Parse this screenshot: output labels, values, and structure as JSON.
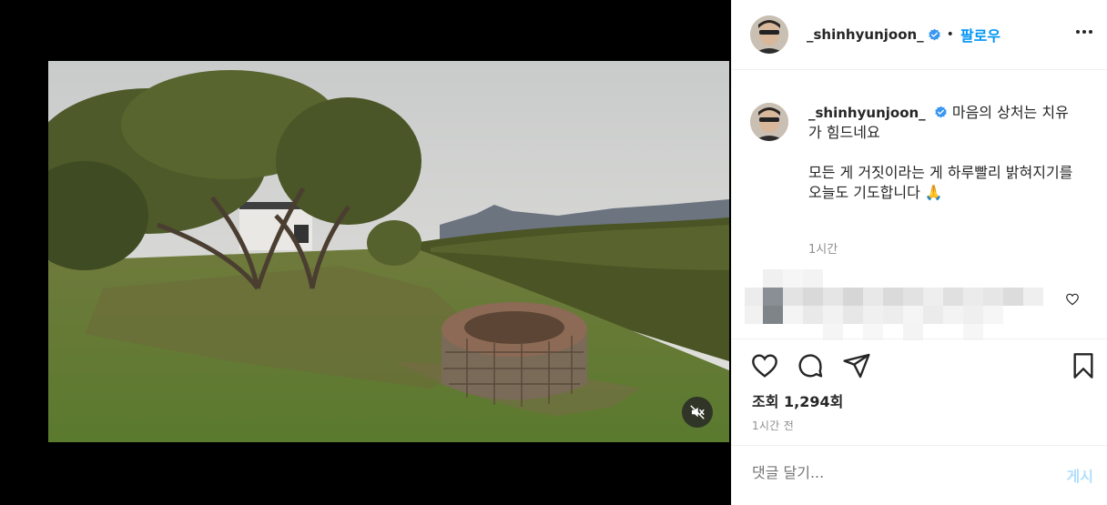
{
  "post": {
    "username": "_shinhyunjoon_",
    "follow_label": "팔로우",
    "dot": "•"
  },
  "caption": {
    "username": "_shinhyunjoon_",
    "text": "마음의 상처는 치유가 힘드네요\n\n모든 게 거짓이라는 게 하루빨리 밝혀지기를\n오늘도 기도합니다 🙏",
    "time": "1시간"
  },
  "stats": {
    "views": "조회 1,294회",
    "posted": "1시간 전"
  },
  "comment": {
    "placeholder": "댓글 달기...",
    "post_label": "게시"
  },
  "icons": {
    "mute": "speaker-muted-icon",
    "like": "heart-icon",
    "comment": "comment-icon",
    "share": "paper-plane-icon",
    "save": "bookmark-icon",
    "more": "more-options-icon",
    "verified": "verified-badge-icon"
  },
  "colors": {
    "accent": "#0095f6",
    "verified": "#3897f0",
    "muted_text": "#8e8e8e",
    "post_disabled": "#b2dffc"
  }
}
